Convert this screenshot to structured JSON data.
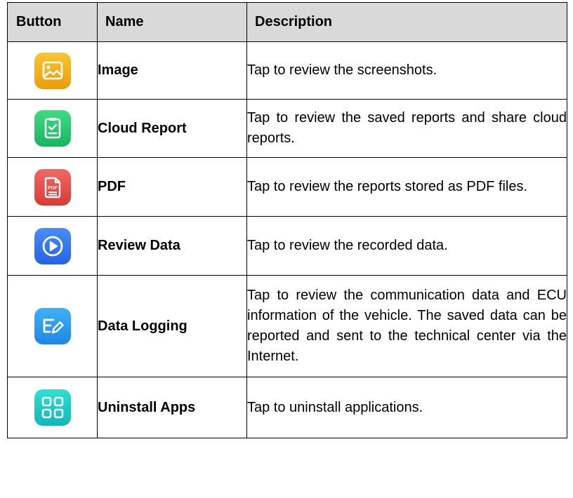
{
  "header": {
    "button": "Button",
    "name": "Name",
    "description": "Description"
  },
  "rows": [
    {
      "icon": "image-icon",
      "name": "Image",
      "description": "Tap to review the screenshots."
    },
    {
      "icon": "cloud-report-icon",
      "name": "Cloud Report",
      "description": "Tap to review the saved reports and share cloud reports."
    },
    {
      "icon": "pdf-icon",
      "name": "PDF",
      "description": "Tap to review the reports stored as PDF files."
    },
    {
      "icon": "review-data-icon",
      "name": "Review Data",
      "description": "Tap to review the recorded data."
    },
    {
      "icon": "data-logging-icon",
      "name": "Data Logging",
      "description": "Tap to review the communication data and ECU information of the vehicle. The saved data can be reported and sent to the technical center via the Internet."
    },
    {
      "icon": "uninstall-apps-icon",
      "name": "Uninstall Apps",
      "description": "Tap to uninstall applications."
    }
  ],
  "colors": {
    "header_bg": "#d9d9d9",
    "image_icon": "#f5b321",
    "cloud_report_icon": "#22c46d",
    "pdf_icon": "#e4483f",
    "review_data_icon": "#3375ee",
    "data_logging_icon": "#2a9bee",
    "uninstall_apps_icon": "#1ccbc4"
  }
}
